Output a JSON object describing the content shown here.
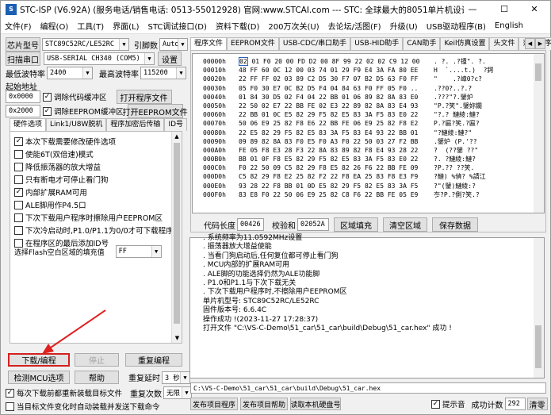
{
  "title": "STC-ISP (V6.92A) (服务电话/销售电话: 0513-55012928) 官网:www.STCAI.com --- STC: 全球最大的8051单片机设计公司 (姚永平)",
  "menu": [
    "文件(F)",
    "编程(O)",
    "工具(T)",
    "界面(L)",
    "STC调试接口(D)",
    "资料下载(D)",
    "200万次关(U)",
    "去论坛/活图(F)",
    "升级(U)",
    "USB驱动程序(B)",
    "English"
  ],
  "left": {
    "chip_label": "芯片型号",
    "chip_value": "STC89C52RC/LE52RC",
    "pin_label": "引脚数",
    "pin_value": "Auto",
    "scan_btn": "扫描串口",
    "port_value": "USB-SERIAL CH340 (COM5)",
    "settings_btn": "设置",
    "min_baud_label": "最低波特率",
    "min_baud": "2400",
    "max_baud_label": "最高波特率",
    "max_baud": "115200",
    "start_addr_label": "起始地址",
    "addr1": "0x0000",
    "clear_code": "调除代码缓冲区",
    "open_prog": "打开程序文件",
    "addr2": "0x2000",
    "clear_eeprom": "调除EEPROM缓冲区",
    "open_eeprom": "打开EEPROM文件",
    "tabs": [
      "硬件选项",
      "Link1/U8W脱机",
      "程序加密后传输",
      "ID号"
    ],
    "options": [
      {
        "label": "本次下载需要修改硬件选项",
        "checked": "✓"
      },
      {
        "label": "使能6T(双倍速)模式",
        "checked": ""
      },
      {
        "label": "降低振荡器的放大增益",
        "checked": ""
      },
      {
        "label": "只有断电才可停止看门狗",
        "checked": ""
      },
      {
        "label": "内部扩展RAM可用",
        "checked": "✓"
      },
      {
        "label": "ALE脚用作P4.5口",
        "checked": ""
      },
      {
        "label": "下次下载用户程序时擦除用户EEPROM区",
        "checked": ""
      },
      {
        "label": "下次冷启动时,P1.0/P1.1为0/0才可下载程序",
        "checked": ""
      },
      {
        "label": "在程序区的最后添加ID号",
        "checked": ""
      }
    ],
    "fill_label": "选择Flash空白区域的填充值",
    "fill_value": "FF",
    "download_btn": "下载/编程",
    "stop_btn": "停止",
    "reprogram_btn": "重复编程",
    "check_mcu_btn": "检测MCU选项",
    "help_btn": "帮助",
    "delay_label": "重复延时",
    "delay_value": "3 秒",
    "count_label": "重复次数",
    "count_value": "无限",
    "reload_label": "每次下载前都重新装载目标文件",
    "auto_label": "当目标文件变化时自动装载并发送下载命令"
  },
  "right": {
    "tabs": [
      "程序文件",
      "EEPROM文件",
      "USB-CDC/串口助手",
      "USB-HID助手",
      "CAN助手",
      "Keil仿真设置",
      "头文件",
      "范例程序",
      "I"
    ],
    "hex_rows": [
      {
        "a": "00000h",
        "b": "02 01 F0 20 00 FD D2 00 8F 99 22 02 02 C9 12 00",
        "c": ". ?. .?锺\". ?."
      },
      {
        "a": "00010h",
        "b": "48 FF 60 0C 12 00 03 74 01 29 F9 E4 3A FA 80 EE",
        "c": "H  `....t.)  ?鍔"
      },
      {
        "a": "00020h",
        "b": "22 FF FF 02 03 89 C2 D5 30 F7 07 B2 D5 63 F0 FF",
        "c": "\"    .?嶂0?c?"
      },
      {
        "a": "00030h",
        "b": "05 F0 30 E7 0C B2 D5 F4 04 84 63 F0 FF 05 F0 ..",
        "c": ".??0?..?.?"
      },
      {
        "a": "00040h",
        "b": "01 84 30 D5 02 F4 04 22 BB 01 06 89 82 8A 83 E0",
        "c": ".???\"?.鐾炉"
      },
      {
        "a": "00050h",
        "b": "22 50 02 E7 22 BB FE 02 E3 22 89 82 8A 83 E4 93",
        "c": "\"P.?笑\".鐾妳鐗"
      },
      {
        "a": "00060h",
        "b": "22 BB 01 0C E5 82 29 F5 82 E5 83 3A F5 83 E0 22",
        "c": "\"?.? 鰱綾:鰱?"
      },
      {
        "a": "00070h",
        "b": "50 06 E9 25 82 F8 E6 22 BB FE 06 E9 25 82 F8 E2",
        "c": "P.?匾?笑.?匾?"
      },
      {
        "a": "00080h",
        "b": "22 E5 82 29 F5 82 E5 83 3A F5 83 E4 93 22 BB 01",
        "c": "\"?鰱綾:鰱?\""
      },
      {
        "a": "00090h",
        "b": "09 89 82 8A 83 F0 E5 F0 A3 F0 22 50 03 27 F2 BB",
        "c": ".鐾炉 (P.'??"
      },
      {
        "a": "000A0h",
        "b": "FE 05 F8 E3 28 F3 22 8A 83 89 82 F8 E4 93 28 22",
        "c": "?  (??鐾 ??\""
      },
      {
        "a": "000B0h",
        "b": "BB 01 0F F8 E5 82 29 F5 82 E5 83 3A F5 83 E0 22",
        "c": "?. ?鰱綾:鰱?"
      },
      {
        "a": "000C0h",
        "b": "F0 22 50 09 C5 82 29 F8 E5 82 26 F6 22 BB FE 09",
        "c": "?P.?? ??笑."
      },
      {
        "a": "000D0h",
        "b": "C5 82 29 F8 E2 25 82 F2 22 F8 EA 25 83 F8 E3 F9",
        "c": "?鰱) %偵? %請江"
      },
      {
        "a": "000E0h",
        "b": "93 28 22 F8 BB 01 0D E5 82 29 F5 82 E5 83 3A F5",
        "c": "?\"(鐾)鰱綾:?"
      },
      {
        "a": "000F0h",
        "b": "83 E8 F0 22 50 06 E9 25 82 C8 F6 22 BB FE 05 E9",
        "c": "冭?P.?側?笑.?"
      }
    ],
    "code_len_label": "代码长度",
    "code_len": "00426",
    "checksum_label": "校验和",
    "checksum": "02052A",
    "fill_btn": "区域填充",
    "clear_btn": "清空区域",
    "save_btn": "保存数据",
    "log_lines": [
      ". 系统频率为11.0592MHz设置",
      ". 振荡器放大增益使能",
      ". 当看门狗启动后,任何复位都可停止看门狗",
      ". MCU内部的扩展RAM可用",
      ". ALE脚的功能选择仍然为ALE功能脚",
      ". P1.0和P1.1与下次下载无关",
      ". 下次下载用户程序时,不擦除用户EEPROM区",
      "",
      "单片机型号: STC89C52RC/LE52RC",
      "固件版本号: 6.6.4C",
      "",
      "",
      "",
      "操作成功 !(2023-11-27 17:28:37)",
      "打开文件 \"C:\\VS-C-Demo\\51_car\\51_car\\build\\Debug\\51_car.hex\" 成功 !"
    ],
    "path": "C:\\VS-C-Demo\\51_car\\51_car\\build\\Debug\\51_car.hex",
    "send_prog_btn": "发布项目程序",
    "send_help_btn": "发布项目帮助",
    "read_hdd_btn": "读取本机硬盘号",
    "prompt_label": "提示音",
    "success_label": "成功计数",
    "success_count": "292",
    "clear_count_btn": "清零"
  }
}
